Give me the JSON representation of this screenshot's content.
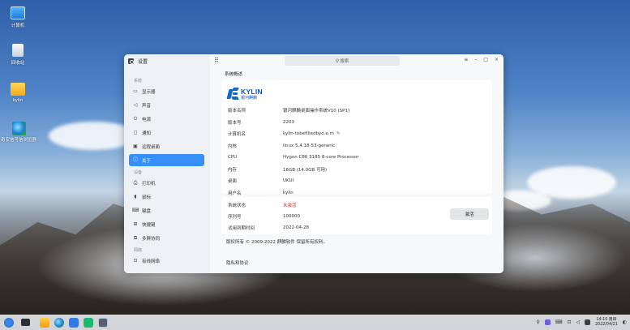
{
  "desktop": {
    "icons": [
      {
        "label": "计算机"
      },
      {
        "label": "回收站"
      },
      {
        "label": "kylin"
      },
      {
        "label": "奇安信可信浏览器"
      }
    ]
  },
  "window": {
    "app_title": "设置",
    "search_placeholder": "搜索",
    "sidebar": {
      "group_system": "系统",
      "system_items": [
        {
          "label": "显示器",
          "icon": "monitor-icon"
        },
        {
          "label": "声音",
          "icon": "speaker-icon"
        },
        {
          "label": "电源",
          "icon": "power-icon"
        },
        {
          "label": "通知",
          "icon": "bell-icon"
        },
        {
          "label": "远程桌面",
          "icon": "remote-icon"
        },
        {
          "label": "关于",
          "icon": "info-icon",
          "active": true
        }
      ],
      "group_devices": "设备",
      "device_items": [
        {
          "label": "打印机",
          "icon": "printer-icon"
        },
        {
          "label": "鼠标",
          "icon": "mouse-icon"
        },
        {
          "label": "键盘",
          "icon": "keyboard-icon"
        },
        {
          "label": "快捷键",
          "icon": "shortcut-icon"
        },
        {
          "label": "多屏协同",
          "icon": "multiscreen-icon"
        }
      ],
      "group_network": "网络",
      "network_items": [
        {
          "label": "有线网络",
          "icon": "ethernet-icon"
        }
      ]
    },
    "about": {
      "section_title": "系统概述",
      "logo": {
        "brand": "KYLIN",
        "brand_cn": "银河麒麟"
      },
      "info_rows": [
        {
          "key": "版本名称",
          "value": "银河麒麟桌面操作系统V10 (SP1)"
        },
        {
          "key": "版本号",
          "value": "2203"
        },
        {
          "key": "计算机名",
          "value": "kylin-tobefilledbyo.e.m"
        },
        {
          "key": "内核",
          "value": "linux 5.4.18-53-generic"
        },
        {
          "key": "CPU",
          "value": "Hygon C86 3185  8-core Processor"
        },
        {
          "key": "内存",
          "value": "16GB (14.0GB 可用)"
        },
        {
          "key": "桌面",
          "value": "UKUI"
        },
        {
          "key": "用户名",
          "value": "kylin"
        }
      ],
      "activation": {
        "status_key": "系统状态",
        "status_value": "未激活",
        "serial_key": "序列号",
        "serial_value": "100000",
        "trial_key": "试用到期时间",
        "trial_value": "2022-04-28",
        "button_label": "激活"
      },
      "copyright": "版权所有 © 2009-2022 麒麟软件 保留所有权利。",
      "privacy_title": "隐私和协议"
    }
  },
  "taskbar": {
    "clock_time": "14:10 周四",
    "clock_date": "2022/04/21"
  },
  "colors": {
    "accent": "#3790fa",
    "inactive_red": "#e0302b"
  }
}
